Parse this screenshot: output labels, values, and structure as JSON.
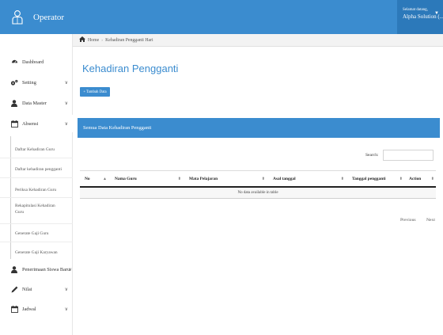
{
  "header": {
    "brand_title": "Operator",
    "greeting": "Selamat datang,",
    "user_name": "Alpha Solution (...",
    "accent_color": "#3b8ccf"
  },
  "sidebar": {
    "items": [
      {
        "label": "Dashboard",
        "icon": "dashboard-icon"
      },
      {
        "label": "Setting",
        "icon": "gears-icon"
      },
      {
        "label": "Data Master",
        "icon": "user-icon"
      },
      {
        "label": "Absensi",
        "icon": "calendar-icon"
      },
      {
        "label": "Penerimaan Siswa Baru",
        "icon": "user-icon"
      },
      {
        "label": "Nilai",
        "icon": "pencil-icon"
      },
      {
        "label": "Jadwal",
        "icon": "calendar-icon"
      }
    ],
    "absensi_sub": [
      "Daftar Kehadiran Guru",
      "Daftar kehadiran pengganti",
      "Periksa Kehadiran Guru",
      "Rekapitulasi Kehadiran Guru",
      "Generate Gaji Guru",
      "Generate Gaji Karyawan"
    ]
  },
  "breadcrumb": {
    "home": "Home",
    "current": "Kehadiran Pengganti Hari"
  },
  "main": {
    "page_title": "Kehadiran Pengganti",
    "add_button": "Tambah Data",
    "panel_title": "Semua Data Kehadiran Pengganti",
    "search_label": "Search:",
    "search_value": "",
    "columns": [
      "No",
      "Nama Guru",
      "Mata Pelajaran",
      "Asal tanggal",
      "Tanggal pengganti",
      "Action"
    ],
    "empty_message": "No data available in table",
    "prev_label": "Previous",
    "next_label": "Next"
  }
}
